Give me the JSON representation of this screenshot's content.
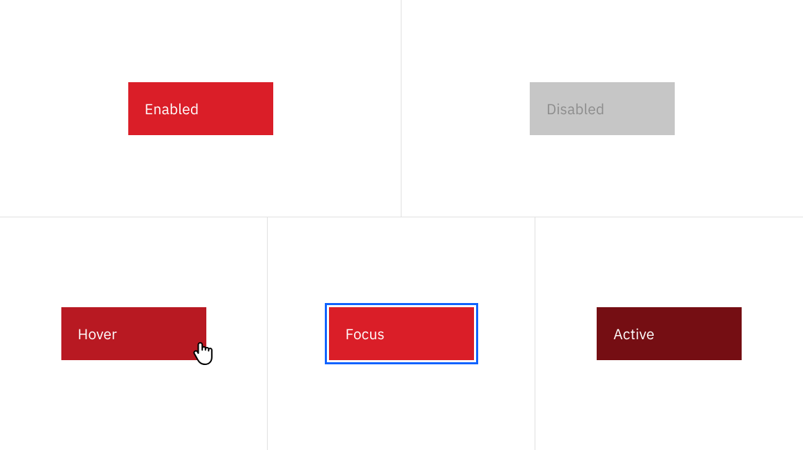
{
  "states": {
    "enabled": {
      "label": "Enabled",
      "bg": "#da1e28",
      "text": "#ffffff"
    },
    "disabled": {
      "label": "Disabled",
      "bg": "#c6c6c6",
      "text": "#8d8d8d"
    },
    "hover": {
      "label": "Hover",
      "bg": "#b81922",
      "text": "#ffffff"
    },
    "focus": {
      "label": "Focus",
      "bg": "#da1e28",
      "text": "#ffffff",
      "ring": "#0f62fe"
    },
    "active": {
      "label": "Active",
      "bg": "#750e13",
      "text": "#ffffff"
    }
  }
}
